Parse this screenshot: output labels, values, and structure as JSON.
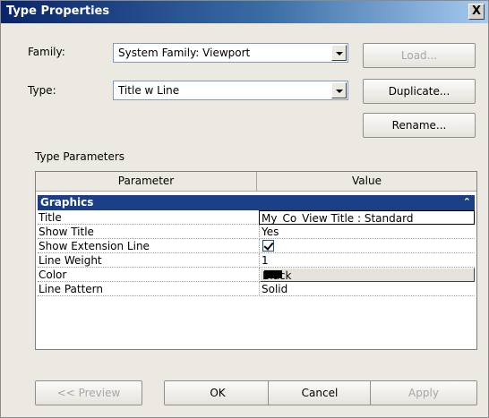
{
  "window": {
    "title": "Type Properties",
    "close_label": "X"
  },
  "family": {
    "label": "Family:",
    "value": "System Family: Viewport"
  },
  "type": {
    "label": "Type:",
    "value": "Title w Line"
  },
  "buttons": {
    "load": "Load...",
    "duplicate": "Duplicate...",
    "rename": "Rename..."
  },
  "type_parameters": {
    "label": "Type Parameters",
    "columns": [
      "Parameter",
      "Value"
    ],
    "group": {
      "name": "Graphics",
      "collapse_glyph": "»"
    },
    "rows": [
      {
        "name": "Title",
        "value": "My_Co_View Title : Standard"
      },
      {
        "name": "Show Title",
        "value": "Yes"
      },
      {
        "name": "Show Extension Line",
        "value": ""
      },
      {
        "name": "Line Weight",
        "value": "1"
      },
      {
        "name": "Color",
        "value": "Black"
      },
      {
        "name": "Line Pattern",
        "value": "Solid"
      }
    ]
  },
  "show_extension_line_checked": true,
  "footer": {
    "preview": "<< Preview",
    "ok": "OK",
    "cancel": "Cancel",
    "apply": "Apply"
  },
  "colors": {
    "titlebar_start": "#0a246a",
    "group_header": "#1b3f86",
    "dialog_bg": "#ece9e2"
  }
}
